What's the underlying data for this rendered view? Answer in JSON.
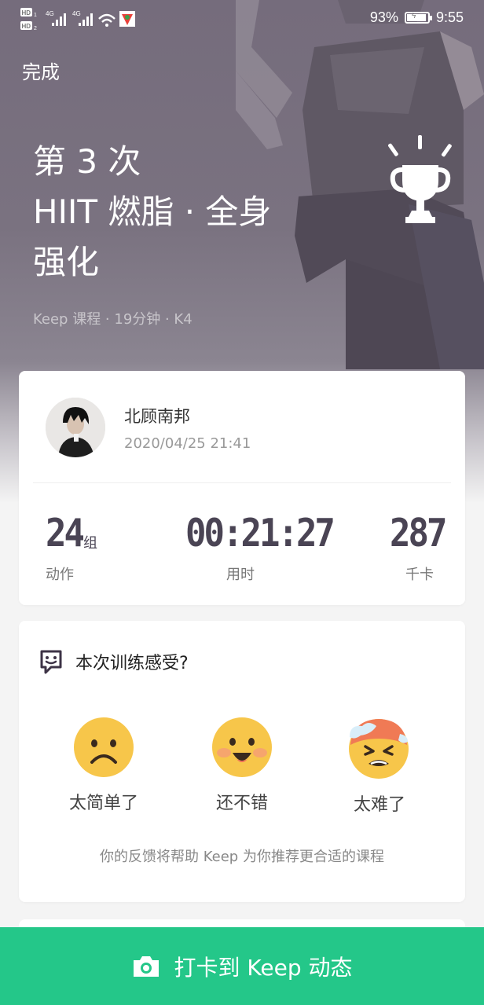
{
  "status_bar": {
    "network_1": "4G",
    "network_2": "4G",
    "battery_percent": "93%",
    "battery_level": 0.93,
    "time": "9:55"
  },
  "header": {
    "done_label": "完成"
  },
  "course": {
    "title_line1": "第 3 次",
    "title_line2": "HIIT 燃脂 · 全身",
    "title_line3": "强化",
    "meta": "Keep 课程 · 19分钟 · K4",
    "trophy_icon": "trophy-icon"
  },
  "user": {
    "name": "北顾南邦",
    "datetime": "2020/04/25 21:41"
  },
  "stats": [
    {
      "value": "24",
      "unit": "组",
      "label": "动作"
    },
    {
      "value": "00:21:27",
      "unit": "",
      "label": "用时"
    },
    {
      "value": "287",
      "unit": "",
      "label": "千卡"
    }
  ],
  "feedback": {
    "question": "本次训练感受?",
    "options": [
      {
        "label": "太简单了",
        "icon": "sad-face-icon"
      },
      {
        "label": "还不错",
        "icon": "happy-face-icon"
      },
      {
        "label": "太难了",
        "icon": "exhausted-face-icon"
      }
    ],
    "note": "你的反馈将帮助 Keep 为你推荐更合适的课程"
  },
  "bottom_bar": {
    "label": "打卡到 Keep 动态",
    "icon": "camera-icon"
  },
  "colors": {
    "accent": "#24c789",
    "emoji_yellow": "#f7c64a",
    "stat_text": "#4a4454"
  }
}
